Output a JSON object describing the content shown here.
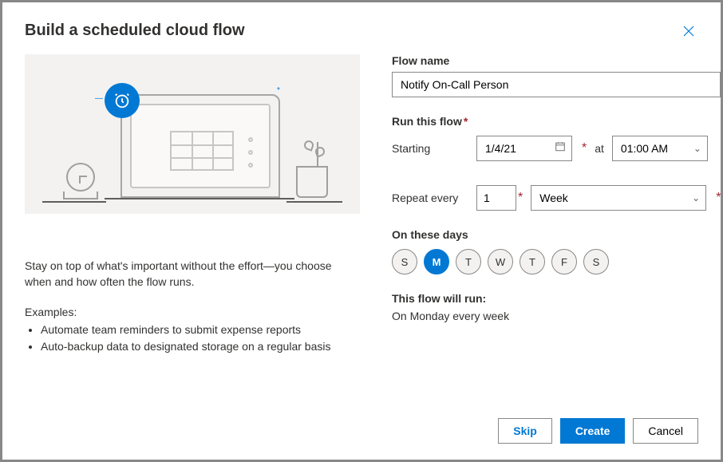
{
  "dialog": {
    "title": "Build a scheduled cloud flow",
    "description": "Stay on top of what's important without the effort—you choose when and how often the flow runs.",
    "examples_label": "Examples:",
    "examples": [
      "Automate team reminders to submit expense reports",
      "Auto-backup data to designated storage on a regular basis"
    ]
  },
  "form": {
    "flow_name_label": "Flow name",
    "flow_name_value": "Notify On-Call Person",
    "run_label": "Run this flow",
    "starting_label": "Starting",
    "starting_value": "1/4/21",
    "at_label": "at",
    "time_value": "01:00 AM",
    "repeat_label": "Repeat every",
    "repeat_count": "1",
    "repeat_unit": "Week",
    "days_label": "On these days",
    "days": [
      {
        "label": "S",
        "name": "sunday",
        "selected": false
      },
      {
        "label": "M",
        "name": "monday",
        "selected": true
      },
      {
        "label": "T",
        "name": "tuesday",
        "selected": false
      },
      {
        "label": "W",
        "name": "wednesday",
        "selected": false
      },
      {
        "label": "T",
        "name": "thursday",
        "selected": false
      },
      {
        "label": "F",
        "name": "friday",
        "selected": false
      },
      {
        "label": "S",
        "name": "saturday",
        "selected": false
      }
    ],
    "summary_label": "This flow will run:",
    "summary_text": "On Monday every week"
  },
  "footer": {
    "skip": "Skip",
    "create": "Create",
    "cancel": "Cancel"
  }
}
